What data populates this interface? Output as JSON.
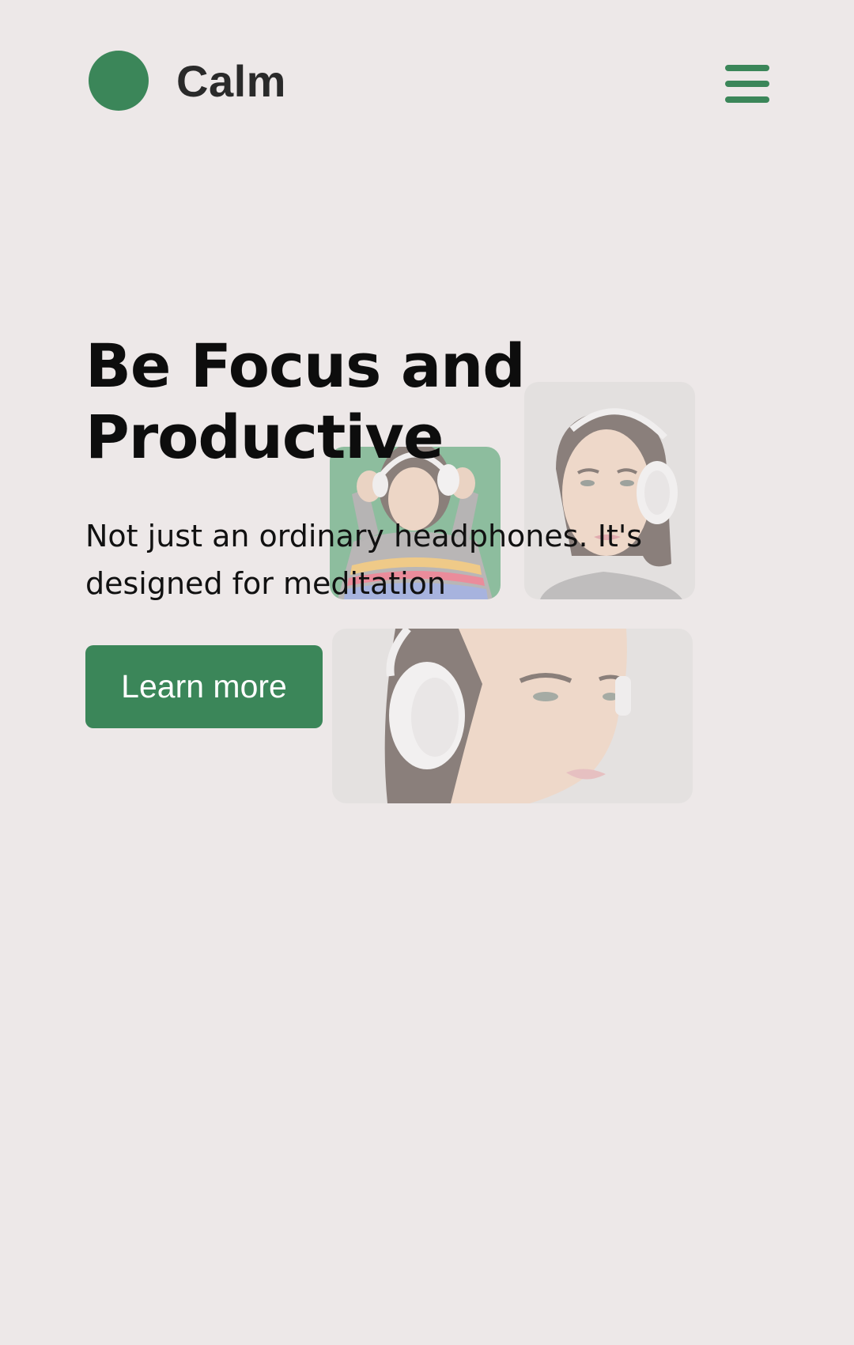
{
  "header": {
    "brand": "Calm",
    "menu_label": "Menu"
  },
  "hero": {
    "title_line1": "Be Focus and",
    "title_line2": "Productive",
    "subtitle": "Not just an ordinary headphones. It's designed for meditation",
    "cta_label": "Learn more"
  },
  "icons": {
    "logo": "green-circle-logo-icon",
    "menu": "hamburger-menu-icon"
  },
  "colors": {
    "background": "#ede8e8",
    "accent": "#3b8659",
    "text": "#111111",
    "button_text": "#ffffff"
  }
}
